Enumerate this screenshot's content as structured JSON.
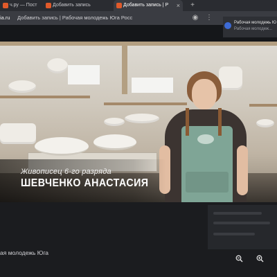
{
  "browser": {
    "tabs": [
      {
        "label": "ч.ру — Пост"
      },
      {
        "label": "Добавить запись"
      },
      {
        "label": "Добавить запись | Р"
      }
    ],
    "address_bar": {
      "domain": "ia.ru",
      "page_title": "Добавить запись | Рабочая молодежь Юга Росс"
    }
  },
  "sidebar_card": {
    "line1": "Рабочая молодежь Ю",
    "line2": "Рабочая молодеж..."
  },
  "video": {
    "caption_subtitle": "Живописец 6-го разряда",
    "caption_name": "ШЕВЧЕНКО АНАСТАСИЯ"
  },
  "page": {
    "title_fragment": "ая молодежь Юга"
  },
  "controls": {
    "zoom_out_icon": "zoom-out-icon",
    "zoom_in_icon": "zoom-in-icon"
  }
}
